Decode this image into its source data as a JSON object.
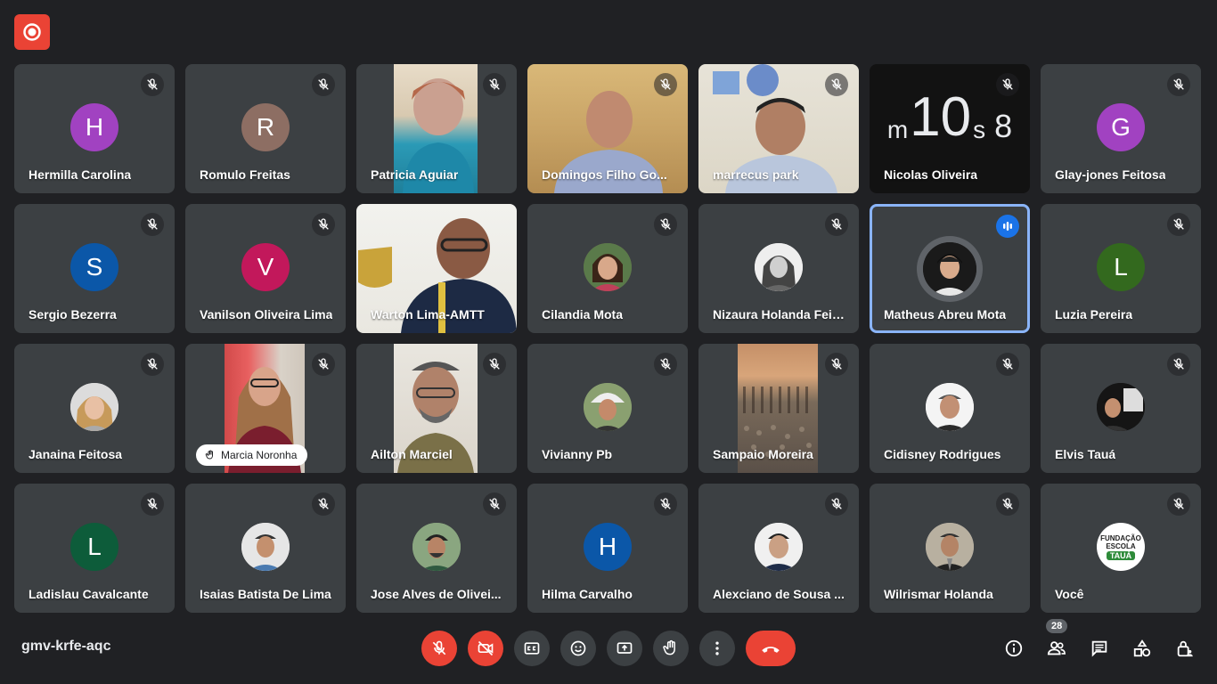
{
  "meeting": {
    "code": "gmv-krfe-aqc",
    "participant_count": "28"
  },
  "participants": [
    {
      "name": "Hermilla Carolina",
      "initial": "H",
      "color": "#a142c1"
    },
    {
      "name": "Romulo Freitas",
      "initial": "R",
      "color": "#8d6e63"
    },
    {
      "name": "Patricia Aguiar"
    },
    {
      "name": "Domingos Filho Go..."
    },
    {
      "name": "marrecus park"
    },
    {
      "name": "Nicolas Oliveira",
      "clock": {
        "m": "m",
        "num": "10",
        "s": "s",
        "extra": "8"
      }
    },
    {
      "name": "Glay-jones Feitosa",
      "initial": "G",
      "color": "#a142c1"
    },
    {
      "name": "Sergio Bezerra",
      "initial": "S",
      "color": "#0b57a8"
    },
    {
      "name": "Vanilson Oliveira Lima",
      "initial": "V",
      "color": "#c2185b"
    },
    {
      "name": "Warton Lima-AMTT"
    },
    {
      "name": "Cilandia Mota"
    },
    {
      "name": "Nizaura Holanda Feit..."
    },
    {
      "name": "Matheus Abreu Mota"
    },
    {
      "name": "Luzia Pereira",
      "initial": "L",
      "color": "#33691e"
    },
    {
      "name": "Janaina Feitosa"
    },
    {
      "name": "Marcia Noronha"
    },
    {
      "name": "Ailton Marciel"
    },
    {
      "name": "Vivianny Pb"
    },
    {
      "name": "Sampaio Moreira"
    },
    {
      "name": "Cidisney Rodrigues"
    },
    {
      "name": "Elvis Tauá"
    },
    {
      "name": "Ladislau Cavalcante",
      "initial": "L",
      "color": "#0d5c3a"
    },
    {
      "name": "Isaias Batista De Lima"
    },
    {
      "name": "Jose Alves de Olivei..."
    },
    {
      "name": "Hilma Carvalho",
      "initial": "H",
      "color": "#0b57a8"
    },
    {
      "name": "Alexciano de Sousa ..."
    },
    {
      "name": "Wilrismar Holanda"
    },
    {
      "name": "Você",
      "logo": {
        "line1": "FUNDAÇÃO",
        "line2": "ESCOLA",
        "line3": "TAUÁ"
      }
    }
  ],
  "colors": {
    "background": "#202124",
    "tile": "#3c4043",
    "danger": "#ea4335",
    "speaking_border": "#8ab4f8",
    "speaking_badge": "#1a73e8"
  }
}
